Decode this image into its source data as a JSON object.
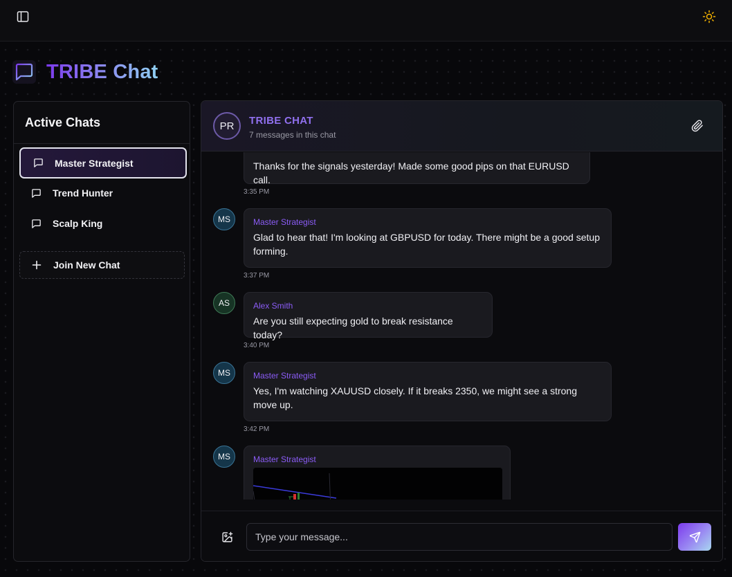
{
  "app": {
    "brand_title": "TRIBE Chat",
    "icons": {
      "sidebar_toggle": "sidebar-toggle-icon",
      "theme_toggle": "sun-icon",
      "logo": "message-square-icon"
    }
  },
  "sidebar": {
    "heading": "Active Chats",
    "items": [
      {
        "label": "Master Strategist",
        "active": true,
        "icon": "message-square-icon"
      },
      {
        "label": "Trend Hunter",
        "active": false,
        "icon": "message-square-icon"
      },
      {
        "label": "Scalp King",
        "active": false,
        "icon": "message-square-icon"
      }
    ],
    "join_label": "Join New Chat"
  },
  "chat": {
    "avatar_initials": "PR",
    "title": "TRIBE CHAT",
    "subtitle": "7 messages in this chat",
    "messages": [
      {
        "sender": "",
        "initials": "",
        "text": "Thanks for the signals yesterday! Made some good pips on that EURUSD call.",
        "time": "3:35 PM"
      },
      {
        "sender": "Master Strategist",
        "initials": "MS",
        "text": "Glad to hear that! I'm looking at GBPUSD for today. There might be a good setup forming.",
        "time": "3:37 PM"
      },
      {
        "sender": "Alex Smith",
        "initials": "AS",
        "text": "Are you still expecting gold to break resistance today?",
        "time": "3:40 PM"
      },
      {
        "sender": "Master Strategist",
        "initials": "MS",
        "text": "Yes, I'm watching XAUUSD closely. If it breaks 2350, we might see a strong move up.",
        "time": "3:42 PM"
      },
      {
        "sender": "Master Strategist",
        "initials": "MS",
        "text": "",
        "time": "",
        "has_image": true
      }
    ]
  },
  "composer": {
    "placeholder": "Type your message...",
    "value": ""
  },
  "colors": {
    "accent": "#8b5cf6",
    "brand_gradient_start": "#7c3aed",
    "brand_gradient_end": "#8fd0f2",
    "background": "#08080b"
  }
}
